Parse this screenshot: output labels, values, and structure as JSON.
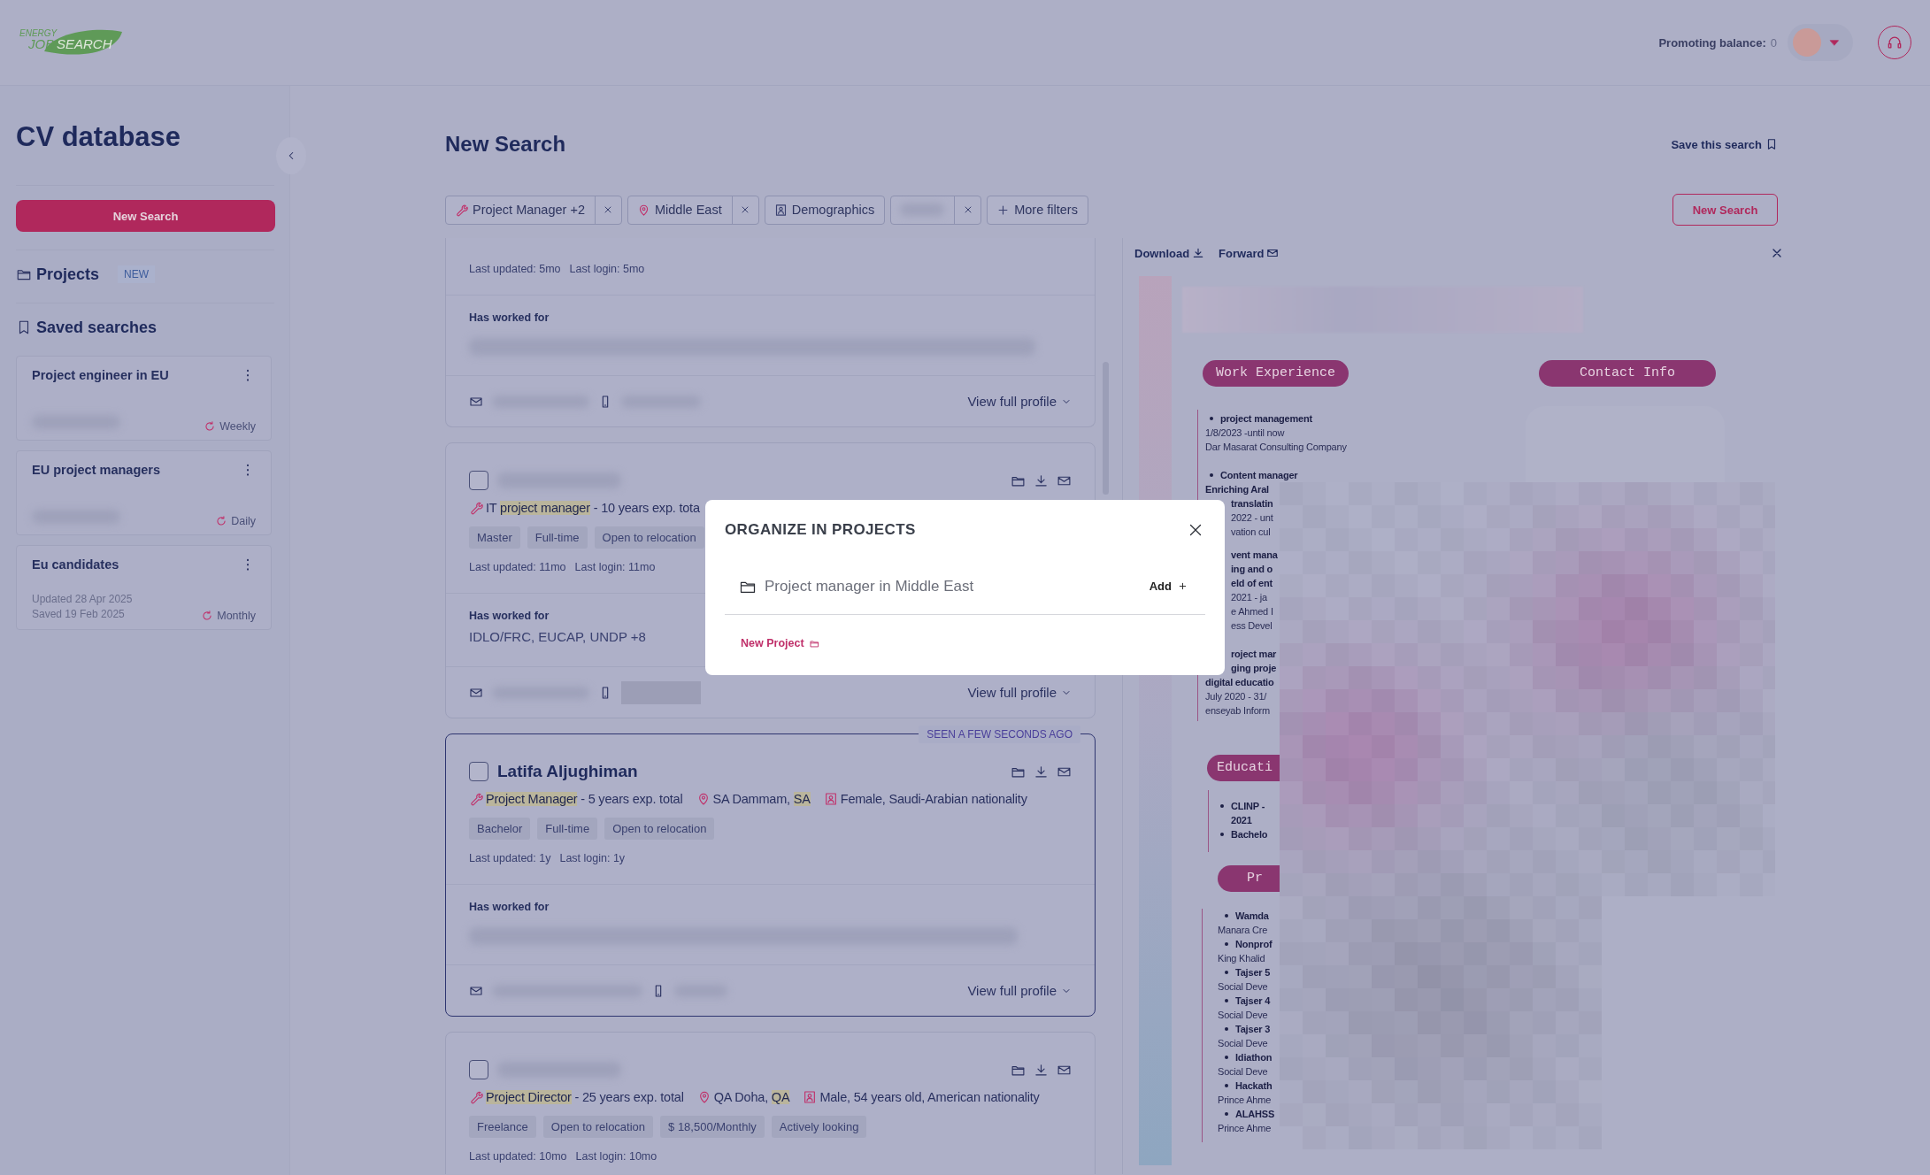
{
  "header": {
    "logo": {
      "top": "ENERGY",
      "left": "JOB",
      "right": "SEARCH"
    },
    "balance_label": "Promoting balance:",
    "balance_value": "0"
  },
  "sidebar": {
    "title": "CV database",
    "new_search": "New Search",
    "projects": {
      "label": "Projects",
      "badge": "NEW"
    },
    "saved_title": "Saved searches",
    "saved": [
      {
        "name": "Project engineer in EU",
        "kind": "redacted",
        "frequency": "Weekly"
      },
      {
        "name": "EU project managers",
        "kind": "redacted",
        "frequency": "Daily"
      },
      {
        "name": "Eu candidates",
        "kind": "dated",
        "details": [
          "Updated 28 Apr 2025",
          "Saved 19 Feb 2025"
        ],
        "frequency": "Monthly"
      }
    ]
  },
  "search": {
    "title": "New Search",
    "save": "Save this search",
    "new_search": "New Search",
    "filters": [
      {
        "kind": "skill",
        "label": "Project Manager +2",
        "removable": true
      },
      {
        "kind": "location",
        "label": "Middle East",
        "removable": true
      },
      {
        "kind": "demographics",
        "label": "Demographics",
        "removable": false
      },
      {
        "kind": "redacted",
        "removable": true
      },
      {
        "kind": "more",
        "label": "More filters",
        "removable": false
      }
    ]
  },
  "results": [
    {
      "kind": "partial",
      "highlighted": false,
      "updated": "Last updated: 5mo",
      "login": "Last login: 5mo",
      "worked_label": "Has worked for",
      "view": "View full profile"
    },
    {
      "kind": "full",
      "highlighted": false,
      "checked": false,
      "title": [
        {
          "text": "IT ",
          "highlight": false
        },
        {
          "text": "project manager",
          "highlight": true
        },
        {
          "text": " - 10 years exp. tota",
          "highlight": false
        }
      ],
      "tags": [
        "Master",
        "Full-time",
        "Open to relocation"
      ],
      "updated": "Last updated: 11mo",
      "login": "Last login: 11mo",
      "worked_label": "Has worked for",
      "worked": "IDLO/FRC, EUCAP, UNDP +8",
      "view": "View full profile"
    },
    {
      "kind": "full",
      "highlighted": true,
      "checked": false,
      "seen": "SEEN A FEW SECONDS AGO",
      "name": "Latifa Aljughiman",
      "title": [
        {
          "text": "Project Manager",
          "highlight": true
        },
        {
          "text": " - 5 years exp. total",
          "highlight": false
        }
      ],
      "location": [
        {
          "text": "SA Dammam, ",
          "highlight": false
        },
        {
          "text": "SA",
          "highlight": true
        }
      ],
      "demographics": "Female, Saudi-Arabian nationality",
      "tags": [
        "Bachelor",
        "Full-time",
        "Open to relocation"
      ],
      "updated": "Last updated: 1y",
      "login": "Last login: 1y",
      "worked_label": "Has worked for",
      "view": "View full profile"
    },
    {
      "kind": "full",
      "highlighted": false,
      "checked": false,
      "title": [
        {
          "text": "Project Director",
          "highlight": true
        },
        {
          "text": " - 25 years exp. total",
          "highlight": false
        }
      ],
      "location": [
        {
          "text": "QA Doha, ",
          "highlight": false
        },
        {
          "text": "QA",
          "highlight": true
        }
      ],
      "demographics": "Male, 54 years old, American nationality",
      "tags": [
        "Freelance",
        "Open to relocation",
        "$ 18,500/Monthly",
        "Actively looking"
      ],
      "updated": "Last updated: 10mo",
      "login": "Last login: 10mo"
    }
  ],
  "panel": {
    "download": "Download",
    "forward": "Forward",
    "cv": {
      "work_title": "Work Experience",
      "contact_title": "Contact Info",
      "work": [
        [
          {
            "text": "project management",
            "kind": "item",
            "bold": true
          },
          {
            "text": "1/8/2023 -until now",
            "kind": "text",
            "bold": false
          },
          {
            "text": "Dar Masarat Consulting Company",
            "kind": "text",
            "bold": false
          }
        ],
        [
          {
            "text": "Content manager",
            "kind": "item",
            "bold": true
          },
          {
            "text": "Enriching Aral",
            "kind": "text",
            "bold": true
          },
          {
            "text": "translatin",
            "kind": "tail",
            "bold": true
          },
          {
            "text": "2022 - unt",
            "kind": "tail",
            "bold": false
          },
          {
            "text": "vation cul",
            "kind": "tail",
            "bold": false
          }
        ],
        [
          {
            "text": "vent mana",
            "kind": "tail",
            "bold": true
          },
          {
            "text": "ing and o",
            "kind": "tail",
            "bold": true
          },
          {
            "text": "eld of ent",
            "kind": "tail",
            "bold": true
          },
          {
            "text": "2021 - ja",
            "kind": "tail",
            "bold": false
          },
          {
            "text": "e Ahmed I",
            "kind": "tail",
            "bold": false
          },
          {
            "text": "ess Devel",
            "kind": "tail",
            "bold": false
          }
        ],
        [
          {
            "text": "roject mar",
            "kind": "tail",
            "bold": true
          },
          {
            "text": "ging proje",
            "kind": "tail",
            "bold": true
          },
          {
            "text": "digital educatio",
            "kind": "text",
            "bold": true
          },
          {
            "text": "July 2020 - 31/",
            "kind": "text",
            "bold": false
          },
          {
            "text": "enseyab Inform",
            "kind": "text",
            "bold": false
          }
        ]
      ],
      "education_title": "Educati",
      "education": [
        [
          {
            "text": "CLINP -",
            "kind": "item",
            "bold": true
          },
          {
            "text": "2021",
            "kind": "wrap",
            "bold": true
          },
          {
            "text": "Bachelo",
            "kind": "item",
            "bold": true
          }
        ]
      ],
      "projects_title": "Pr",
      "projects": [
        [
          {
            "text": "Wamda",
            "kind": "item",
            "bold": true
          },
          {
            "text": "Manara Cre",
            "kind": "text",
            "bold": false
          },
          {
            "text": "Nonprof",
            "kind": "item",
            "bold": true
          },
          {
            "text": "King Khalid",
            "kind": "text",
            "bold": false
          },
          {
            "text": "Tajser 5",
            "kind": "item",
            "bold": true
          },
          {
            "text": "Social Deve",
            "kind": "text",
            "bold": false
          },
          {
            "text": "Tajser 4",
            "kind": "item",
            "bold": true
          },
          {
            "text": "Social Deve",
            "kind": "text",
            "bold": false
          },
          {
            "text": "Tajser 3",
            "kind": "item",
            "bold": true
          },
          {
            "text": "Social Deve",
            "kind": "text",
            "bold": false
          },
          {
            "text": "Idiathon",
            "kind": "item",
            "bold": true
          },
          {
            "text": "Social Deve",
            "kind": "text",
            "bold": false
          },
          {
            "text": "Hackath",
            "kind": "item",
            "bold": true
          },
          {
            "text": "Prince Ahme",
            "kind": "text",
            "bold": false
          },
          {
            "text": "ALAHSS",
            "kind": "item",
            "bold": true
          },
          {
            "text": "Prince Ahme",
            "kind": "text",
            "bold": false
          }
        ]
      ]
    }
  },
  "modal": {
    "title": "ORGANIZE IN PROJECTS",
    "projects": [
      {
        "name": "Project manager in Middle East",
        "action": "Add"
      }
    ],
    "new_project": "New Project"
  }
}
